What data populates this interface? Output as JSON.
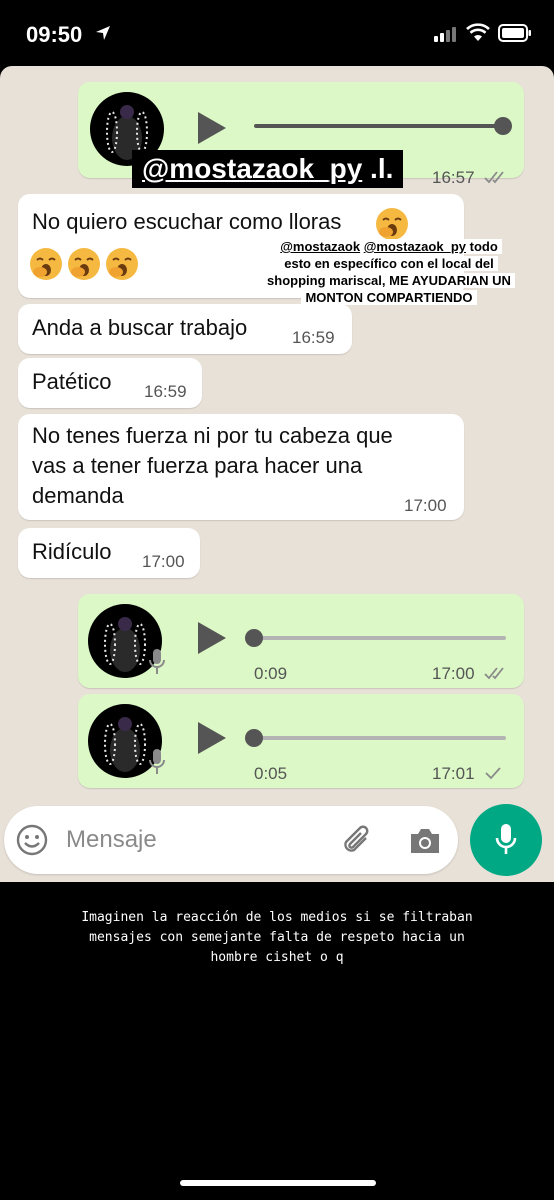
{
  "status": {
    "time": "09:50"
  },
  "tag": {
    "handle": "@mostazaok_py",
    "suffix": " .l."
  },
  "sticker": {
    "line1a": "@mostazaok",
    "line1b": "@mostazaok_py",
    "line1c": " todo",
    "line2": "esto en específico con el local del",
    "line3": "shopping mariscal, ME AYUDARIAN UN",
    "line4": "MONTON COMPARTIENDO"
  },
  "messages": {
    "audio1": {
      "time": "16:57"
    },
    "m1": {
      "text": "No quiero escuchar como lloras"
    },
    "m2": {
      "text": "Anda a buscar trabajo",
      "time": "16:59"
    },
    "m3": {
      "text": "Patético",
      "time": "16:59"
    },
    "m4": {
      "line1": "No tenes fuerza ni por tu cabeza que",
      "line2": "vas a tener fuerza para hacer una",
      "line3": "demanda",
      "time": "17:00"
    },
    "m5": {
      "text": "Ridículo",
      "time": "17:00"
    },
    "audio2": {
      "duration": "0:09",
      "time": "17:00"
    },
    "audio3": {
      "duration": "0:05",
      "time": "17:01"
    }
  },
  "input": {
    "placeholder": "Mensaje"
  },
  "caption": {
    "line1": "Imaginen la reacción de los medios si se filtraban",
    "line2": "mensajes con semejante falta de respeto hacia un",
    "line3": "hombre cishet o q"
  },
  "colors": {
    "outgoing": "#dcf8c6",
    "incoming": "#ffffff",
    "accent": "#00a884",
    "chat_bg": "#e8e1d8"
  },
  "icons": [
    "location-arrow-icon",
    "signal-icon",
    "wifi-icon",
    "battery-icon",
    "play-icon",
    "mic-icon",
    "double-check-icon",
    "single-check-icon",
    "emoji-icon",
    "attach-icon",
    "camera-icon",
    "yawning-face-emoji"
  ]
}
